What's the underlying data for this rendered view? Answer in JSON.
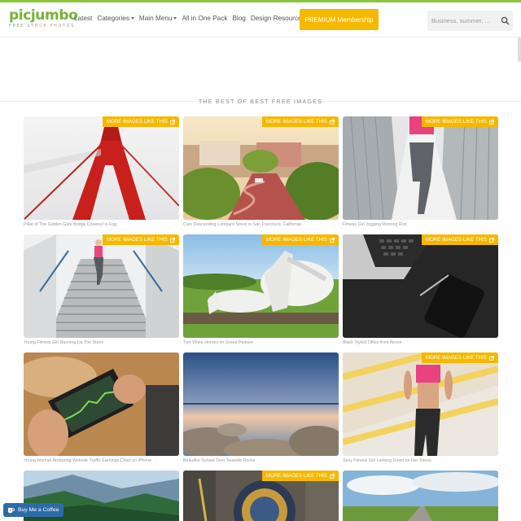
{
  "brand": {
    "name": "picjumbo",
    "tagline": "FREE STOCK PHOTOS"
  },
  "nav": {
    "items": [
      {
        "label": "Latest"
      },
      {
        "label": "Categories"
      },
      {
        "label": "Main Menu"
      },
      {
        "label": "All in One Pack"
      },
      {
        "label": "Blog"
      },
      {
        "label": "Design Resources"
      }
    ],
    "premium_label": "PREMIUM Membership"
  },
  "search": {
    "placeholder": "Business, summer, ..."
  },
  "section": {
    "title": "THE BEST OF BEST FREE IMAGES"
  },
  "badge_label": "MORE IMAGES LIKE THIS",
  "gallery": [
    {
      "caption": "Pillar of The Golden Gate Bridge Covered in Fog",
      "badge": true
    },
    {
      "caption": "Cars Descending Lombard Street in San Francisco, California",
      "badge": true
    },
    {
      "caption": "Fitness Girl Jogging Morning Run",
      "badge": true
    },
    {
      "caption": "Young Fitness Girl Running Up The Stairs",
      "badge": true
    },
    {
      "caption": "Two White Horses on Grand Pasture",
      "badge": true
    },
    {
      "caption": "Black Styled Office from Above",
      "badge": true
    },
    {
      "caption": "Young Woman Analyzing Website Traffic Earnings Chart on iPhone",
      "badge": false
    },
    {
      "caption": "Beautiful Sunset Over Seaside Rocks",
      "badge": false
    },
    {
      "caption": "Sexy Fitness Girl Looking Down on Her Shoes",
      "badge": true
    },
    {
      "caption": "",
      "badge": false
    },
    {
      "caption": "",
      "badge": true
    },
    {
      "caption": "",
      "badge": false
    }
  ],
  "coffee": {
    "label": "Buy Me a Coffee"
  },
  "colors": {
    "accent": "#77b236",
    "premium": "#f5b800",
    "coffee": "#2d6ba8"
  }
}
